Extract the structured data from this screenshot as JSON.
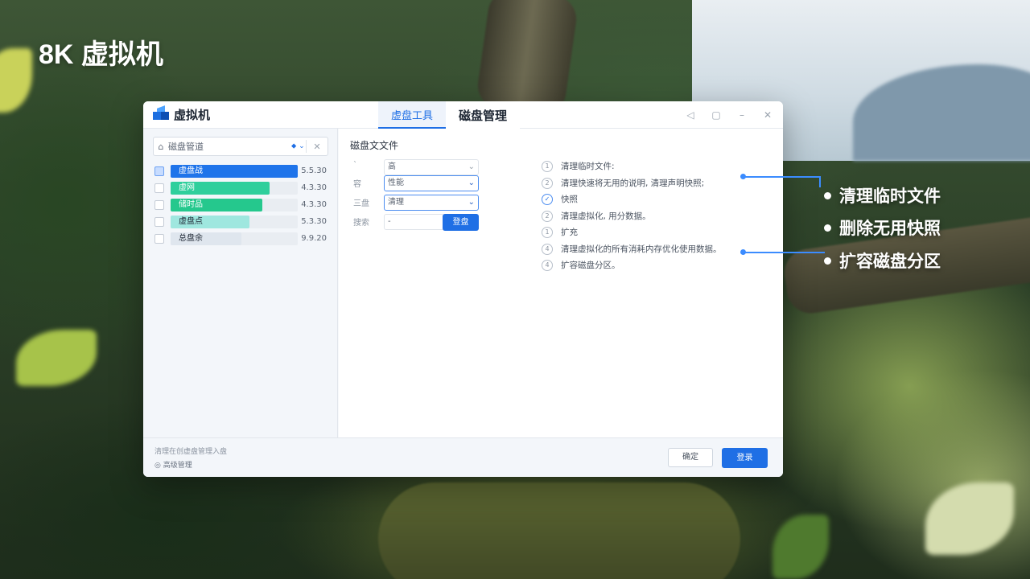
{
  "headline": "8K 虚拟机",
  "window": {
    "app_title": "虚拟机",
    "tabs": [
      {
        "label": "虚盘工具"
      },
      {
        "label": "磁盘管理"
      }
    ],
    "controls": {
      "speaker": "◁",
      "restore": "▢",
      "minimize": "–",
      "close": "✕"
    }
  },
  "sidebar": {
    "search_value": "磁盘管道",
    "search_drop": "⬥ ⌄",
    "search_clear": "✕",
    "disks": [
      {
        "name": "虚盘战",
        "size": "5.5.30",
        "fill": 1.0,
        "color": "#1f74ea",
        "checked": true
      },
      {
        "name": "虚网",
        "size": "4.3.30",
        "fill": 0.78,
        "color": "#2fcf9c",
        "checked": false
      },
      {
        "name": "储时品",
        "size": "4.3.30",
        "fill": 0.72,
        "color": "#25c88d",
        "checked": false
      },
      {
        "name": "虚盘点",
        "size": "5.3.30",
        "fill": 0.62,
        "color": "#9fe7df",
        "checked": false
      },
      {
        "name": "总盘余",
        "size": "9.9.20",
        "fill": 0.56,
        "color": "#dfe6ee",
        "checked": false
      }
    ],
    "footer_line1": "清理在创虚盘管理入盘",
    "footer_line2": "◎ 高级管理"
  },
  "main": {
    "section_title": "磁盘文文件",
    "form": [
      {
        "label": "ˋ",
        "value": "高",
        "focused": false
      },
      {
        "label": "容",
        "value": "性能",
        "focused": true
      },
      {
        "label": "三盘",
        "value": "清理",
        "focused": true
      },
      {
        "label": "搜索",
        "value": "-",
        "focused": false
      }
    ],
    "apply_label": "登盘",
    "steps": [
      {
        "num": "1",
        "text": "清理临时文件:",
        "accent": false
      },
      {
        "num": "2",
        "text": "清理快速将无用的说明, 清理声明快照;",
        "accent": false
      },
      {
        "num": "✓",
        "text": "快照",
        "accent": true
      },
      {
        "num": "2",
        "text": "清理虚拟化, 用分数据。",
        "accent": false
      },
      {
        "num": "1",
        "text": "扩充",
        "accent": false
      },
      {
        "num": "4",
        "text": "清理虚拟化的所有消耗内存优化使用数据。",
        "accent": false
      },
      {
        "num": "4",
        "text": "扩容磁盘分区。",
        "accent": false
      }
    ]
  },
  "footer": {
    "cancel_label": "确定",
    "ok_label": "登录"
  },
  "features": [
    "清理临时文件",
    "删除无用快照",
    "扩容磁盘分区"
  ],
  "colors": {
    "accent": "#1f6fe5",
    "callout": "#3b8cff"
  }
}
